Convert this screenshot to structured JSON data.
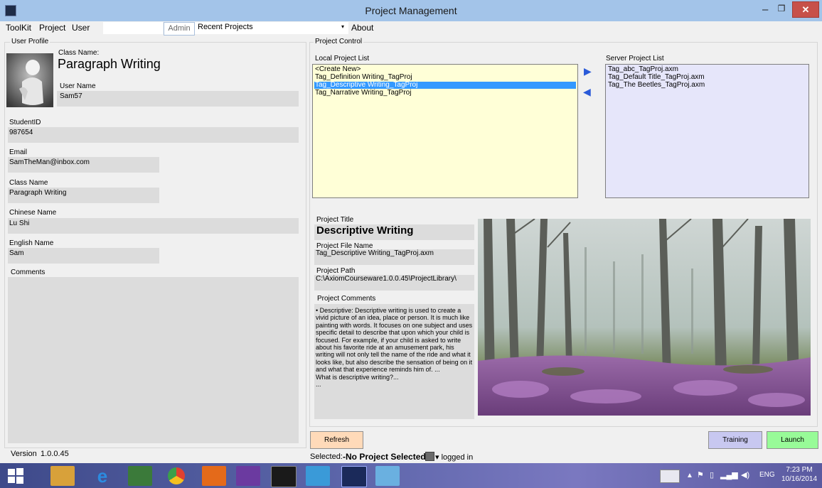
{
  "window": {
    "title": "Project Management",
    "minimize": "–",
    "maximize": "❐",
    "close": "✕"
  },
  "menu": {
    "toolkit": "ToolKit",
    "project": "Project",
    "user": "User",
    "admin": "Admin",
    "recent_projects": "Recent Projects",
    "recent_arrow": "▾",
    "about": "About"
  },
  "user_profile": {
    "group_title": "User Profile",
    "class_name_label": "Class Name:",
    "class_name_display": "Paragraph Writing",
    "user_name_label": "User Name",
    "user_name": "Sam57",
    "student_id_label": "StudentID",
    "student_id": "987654",
    "email_label": "Email",
    "email": "SamTheMan@inbox.com",
    "class_name_field_label": "Class Name",
    "class_name_field": "Paragraph Writing",
    "chinese_name_label": "Chinese Name",
    "chinese_name": "Lu Shi",
    "english_name_label": "English Name",
    "english_name": "Sam",
    "comments_label": "Comments"
  },
  "project_control": {
    "group_title": "Project Control",
    "local_list_label": "Local Project List",
    "local_items": [
      "<Create New>",
      "Tag_Definition Writing_TagProj",
      "Tag_Descriptive Writing_TagProj",
      "Tag_Narrative Writing_TagProj"
    ],
    "selected_local_index": 2,
    "server_list_label": "Server Project List",
    "server_items": [
      "Tag_abc_TagProj.axm",
      "Tag_Default Title_TagProj.axm",
      "Tag_The Beetles_TagProj.axm"
    ],
    "move_right_icon": "▶",
    "move_left_icon": "◀",
    "project_title_label": "Project Title",
    "project_title": "Descriptive Writing",
    "project_file_name_label": "Project File Name",
    "project_file_name": "Tag_Descriptive Writing_TagProj.axm",
    "project_path_label": "Project Path",
    "project_path": "C:\\AxiomCourseware1.0.0.45\\ProjectLibrary\\",
    "project_comments_label": "Project Comments",
    "project_comments": "• Descriptive: Descriptive writing is used to create a vivid picture of an idea, place or person. It is much like painting with words. It focuses on one subject and uses specific detail to describe that upon which your child is focused. For example, if your child is asked to write about his favorite ride at an amusement park, his writing will not only tell the name of the ride and what it looks like, but also describe the sensation of being on it and what that experience reminds him of. ...\nWhat is descriptive writing?...\n..."
  },
  "buttons": {
    "refresh": "Refresh",
    "training": "Training",
    "launch": "Launch"
  },
  "status": {
    "version_label": "Version",
    "version": "1.0.0.45",
    "selected_label": "Selected:",
    "selected_value": "-No Project Selected-",
    "logged_in": "▾ logged in"
  },
  "taskbar": {
    "language": "ENG",
    "time": "7:23 PM",
    "date": "10/16/2014"
  },
  "colors": {
    "local_list_bg": "#ffffd7",
    "server_list_bg": "#e6e6fa",
    "refresh_bg": "#ffdab9",
    "training_bg": "#c8c8f0",
    "launch_bg": "#98fb98",
    "selection": "#3399ff"
  }
}
